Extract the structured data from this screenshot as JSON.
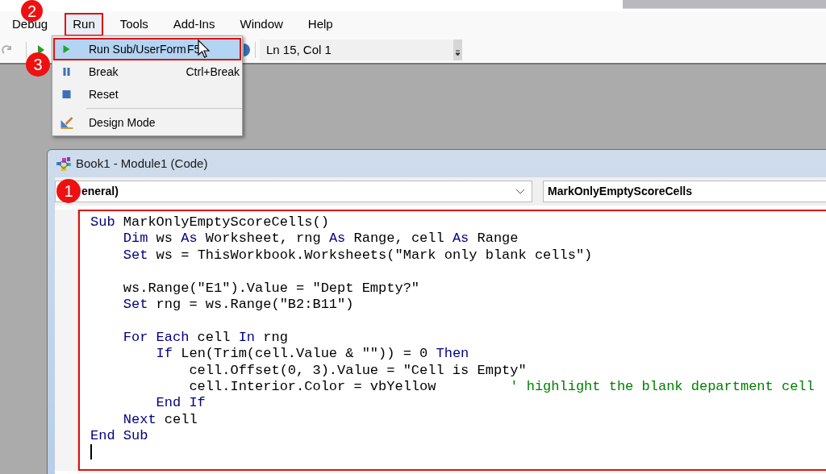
{
  "menu_bar": [
    {
      "label": "Debug",
      "selected": false,
      "annotated": false
    },
    {
      "label": "Run",
      "selected": true,
      "annotated": true
    },
    {
      "label": "Tools",
      "selected": false,
      "annotated": false
    },
    {
      "label": "Add-Ins",
      "selected": false,
      "annotated": false
    },
    {
      "label": "Window",
      "selected": false,
      "annotated": false
    },
    {
      "label": "Help",
      "selected": false,
      "annotated": false
    }
  ],
  "toolbar": {
    "position": "Ln 15, Col 1"
  },
  "run_menu": [
    {
      "kind": "item",
      "label": "Run Sub/UserForm",
      "shortcut": "F5",
      "selected": true,
      "annotated": true
    },
    {
      "kind": "item",
      "label": "Break",
      "shortcut": "Ctrl+Break",
      "selected": false,
      "annotated": false
    },
    {
      "kind": "item",
      "label": "Reset",
      "selected": false,
      "annotated": false
    },
    {
      "kind": "separator"
    },
    {
      "kind": "item",
      "label": "Design Mode",
      "selected": false,
      "annotated": false
    }
  ],
  "code_window": {
    "title": "Book1 - Module1 (Code)",
    "object_box": "eneral)",
    "procedure_box": "MarkOnlyEmptyScoreCells",
    "annotated": true,
    "lines": [
      {
        "kind": "code",
        "segments": [
          {
            "kind": "keyword",
            "text": "Sub"
          },
          {
            "kind": "plain",
            "text": " MarkOnlyEmptyScoreCells()"
          }
        ]
      },
      {
        "kind": "code",
        "segments": [
          {
            "kind": "keyword",
            "text": "    Dim"
          },
          {
            "kind": "plain",
            "text": " ws "
          },
          {
            "kind": "keyword",
            "text": "As"
          },
          {
            "kind": "plain",
            "text": " Worksheet, rng "
          },
          {
            "kind": "keyword",
            "text": "As"
          },
          {
            "kind": "plain",
            "text": " Range, cell "
          },
          {
            "kind": "keyword",
            "text": "As"
          },
          {
            "kind": "plain",
            "text": " Range"
          }
        ]
      },
      {
        "kind": "code",
        "segments": [
          {
            "kind": "keyword",
            "text": "    Set"
          },
          {
            "kind": "plain",
            "text": " ws = ThisWorkbook.Worksheets(\"Mark only blank cells\")"
          }
        ]
      },
      {
        "kind": "blank"
      },
      {
        "kind": "code",
        "segments": [
          {
            "kind": "plain",
            "text": "    ws.Range(\"E1\").Value = \"Dept Empty?\""
          }
        ]
      },
      {
        "kind": "code",
        "segments": [
          {
            "kind": "keyword",
            "text": "    Set"
          },
          {
            "kind": "plain",
            "text": " rng = ws.Range(\"B2:B11\")"
          }
        ]
      },
      {
        "kind": "blank"
      },
      {
        "kind": "code",
        "segments": [
          {
            "kind": "keyword",
            "text": "    For Each"
          },
          {
            "kind": "plain",
            "text": " cell "
          },
          {
            "kind": "keyword",
            "text": "In"
          },
          {
            "kind": "plain",
            "text": " rng"
          }
        ]
      },
      {
        "kind": "code",
        "segments": [
          {
            "kind": "keyword",
            "text": "        If"
          },
          {
            "kind": "plain",
            "text": " Len(Trim(cell.Value & \"\")) = 0 "
          },
          {
            "kind": "keyword",
            "text": "Then"
          }
        ]
      },
      {
        "kind": "code",
        "segments": [
          {
            "kind": "plain",
            "text": "            cell.Offset(0, 3).Value = \"Cell is Empty\""
          }
        ]
      },
      {
        "kind": "code",
        "segments": [
          {
            "kind": "plain",
            "text": "            cell.Interior.Color = vbYellow         "
          },
          {
            "kind": "comment",
            "text": "' highlight the blank department cell"
          }
        ]
      },
      {
        "kind": "code",
        "segments": [
          {
            "kind": "keyword",
            "text": "        End If"
          }
        ]
      },
      {
        "kind": "code",
        "segments": [
          {
            "kind": "keyword",
            "text": "    Next"
          },
          {
            "kind": "plain",
            "text": " cell"
          }
        ]
      },
      {
        "kind": "code",
        "segments": [
          {
            "kind": "keyword",
            "text": "End Sub"
          }
        ]
      },
      {
        "kind": "caret"
      }
    ]
  },
  "step_badges": [
    "1",
    "2",
    "3"
  ]
}
